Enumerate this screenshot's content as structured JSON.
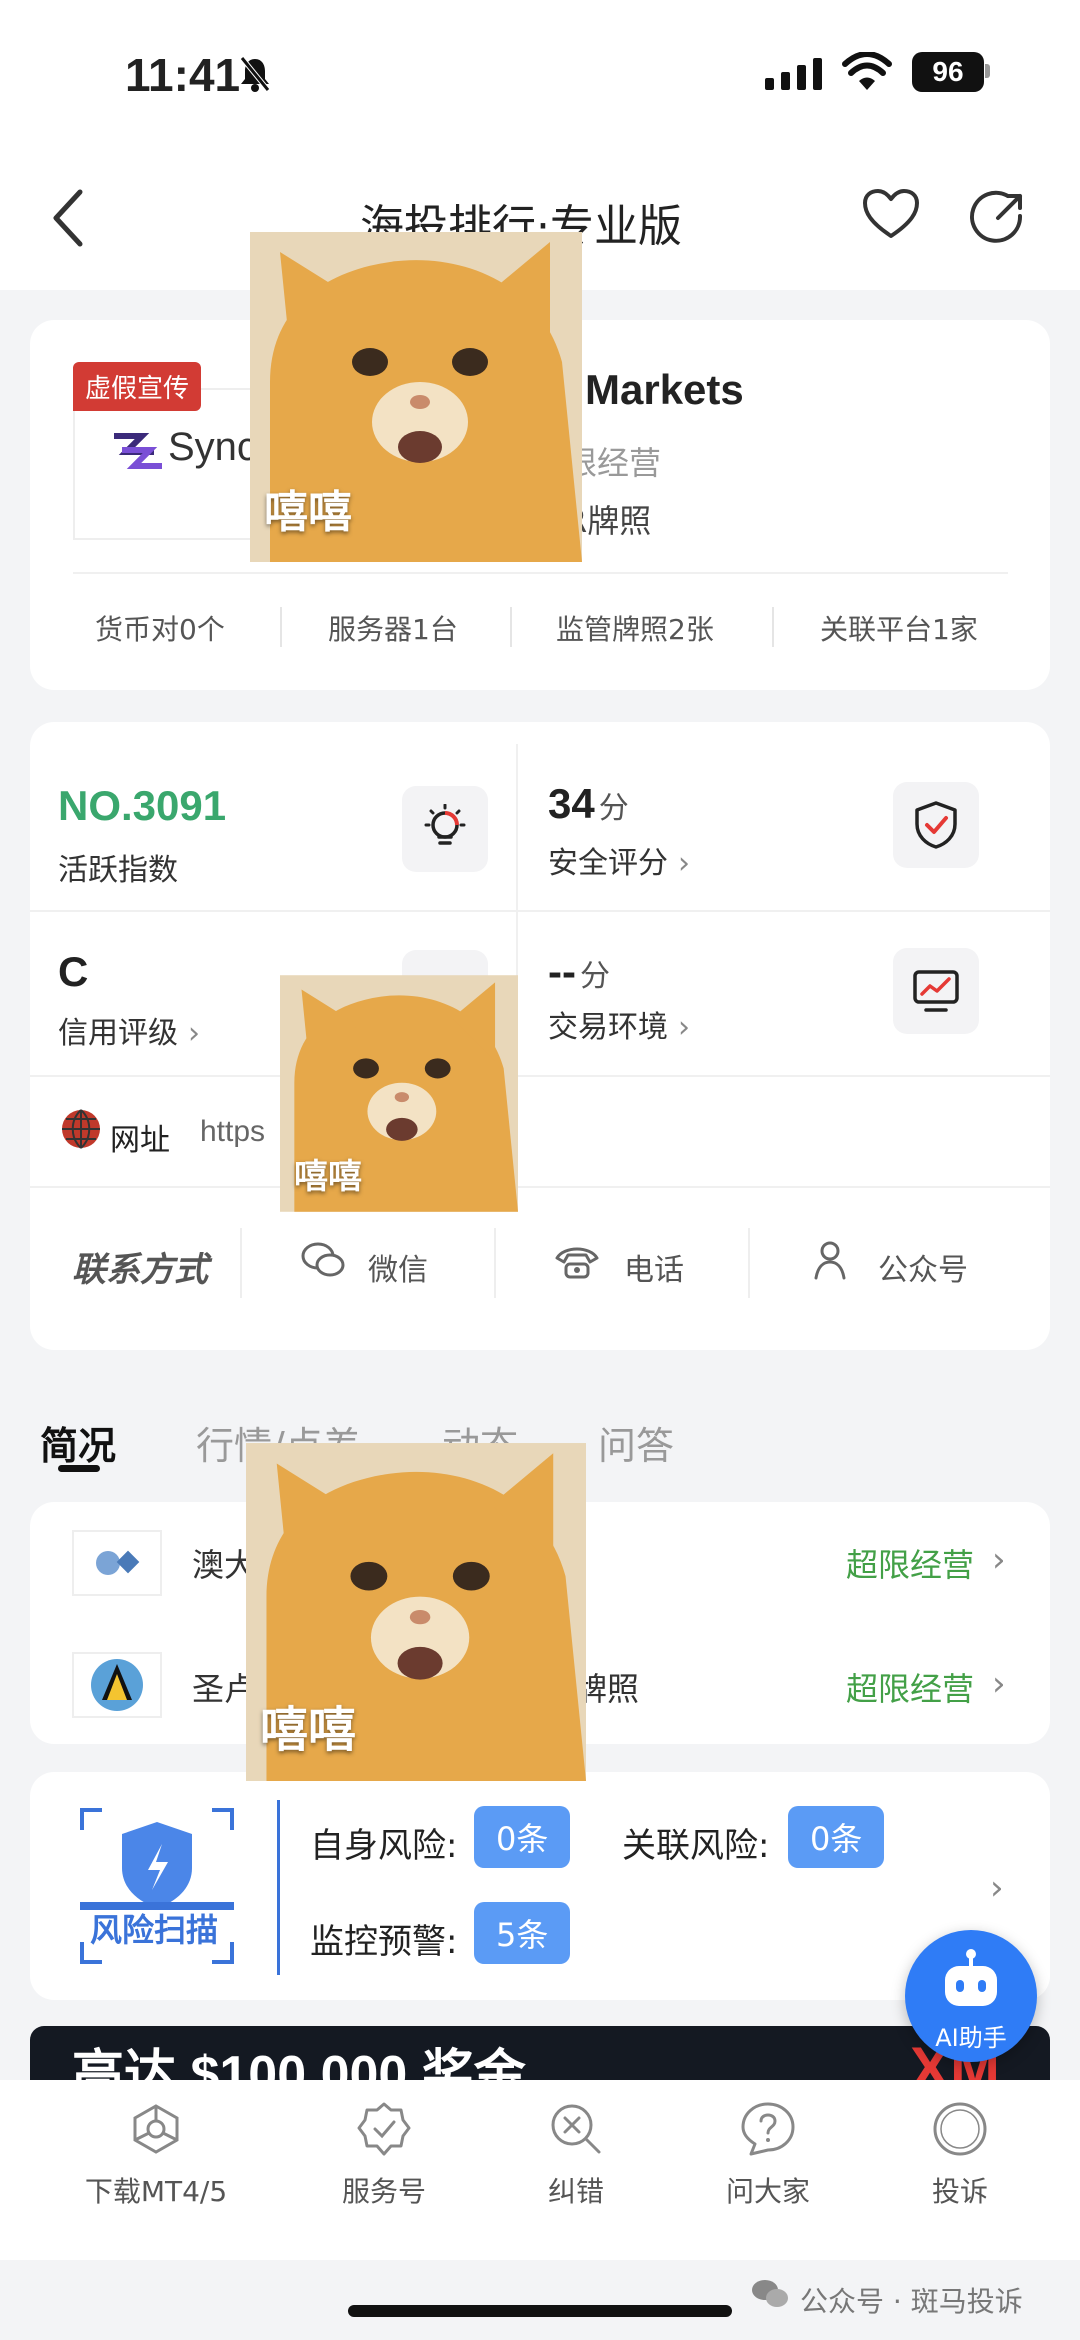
{
  "status_bar": {
    "time": "11:41",
    "battery": "96"
  },
  "header": {
    "title": "海投排行·专业版"
  },
  "broker": {
    "tag": "虚假宣传",
    "logo_text": "Sync",
    "name": "Markets",
    "status": "限经营",
    "license": "R牌照",
    "stats": [
      "货币对0个",
      "服务器1台",
      "监管牌照2张",
      "关联平台1家"
    ]
  },
  "metrics": {
    "rank": "NO.3091",
    "rank_label": "活跃指数",
    "safety_score": "34",
    "score_unit": "分",
    "safety_label": "安全评分",
    "credit": "C",
    "credit_label": "信用评级",
    "trade_env": "--",
    "trade_label": "交易环境"
  },
  "website": {
    "label": "网址",
    "url": "https"
  },
  "contact": {
    "label": "联系方式",
    "wechat": "微信",
    "phone": "电话",
    "official": "公众号"
  },
  "tabs": [
    "简况",
    "行情/点差",
    "动态",
    "问答"
  ],
  "regulators": [
    {
      "name": "澳大",
      "status": "超限经营"
    },
    {
      "name": "圣卢",
      "suffix": "牌照",
      "status": "超限经营"
    }
  ],
  "risk": {
    "badge": "风险扫描",
    "self_label": "自身风险:",
    "self_value": "0条",
    "related_label": "关联风险:",
    "related_value": "0条",
    "monitor_label": "监控预警:",
    "monitor_value": "5条"
  },
  "ai": {
    "label": "AI助手"
  },
  "banner": {
    "text": "高达 $100,000 奖金",
    "logo": "XM"
  },
  "bottom_nav": [
    "下载MT4/5",
    "服务号",
    "纠错",
    "问大家",
    "投诉"
  ],
  "watermark": "公众号 · 斑马投诉",
  "overlay": {
    "caption": "嘻嘻"
  },
  "colors": {
    "green": "#3aa76d",
    "red": "#d23b34",
    "blue": "#5b9bf5",
    "regulator_green": "#43a047"
  }
}
